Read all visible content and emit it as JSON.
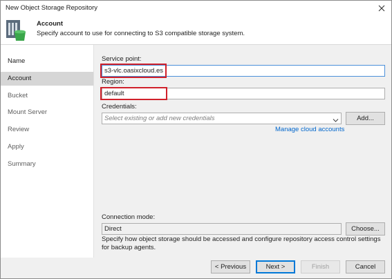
{
  "window": {
    "title": "New Object Storage Repository"
  },
  "header": {
    "title": "Account",
    "subtitle": "Specify account to use for connecting to S3 compatible storage system.",
    "icon": "storage-repository-icon"
  },
  "sidebar": {
    "steps": [
      {
        "label": "Name",
        "state": "done"
      },
      {
        "label": "Account",
        "state": "active"
      },
      {
        "label": "Bucket",
        "state": "pending"
      },
      {
        "label": "Mount Server",
        "state": "pending"
      },
      {
        "label": "Review",
        "state": "pending"
      },
      {
        "label": "Apply",
        "state": "pending"
      },
      {
        "label": "Summary",
        "state": "pending"
      }
    ]
  },
  "form": {
    "service_point": {
      "label": "Service point:",
      "value": "s3-vlc.oasixcloud.es"
    },
    "region": {
      "label": "Region:",
      "value": "default"
    },
    "credentials": {
      "label": "Credentials:",
      "placeholder": "Select existing or add new credentials",
      "add_label": "Add..."
    },
    "manage_link": "Manage cloud accounts",
    "connection_mode": {
      "label": "Connection mode:",
      "value": "Direct",
      "choose_label": "Choose...",
      "description": "Specify how object storage should be accessed and configure repository access control settings for backup agents."
    }
  },
  "footer": {
    "previous": "< Previous",
    "next": "Next >",
    "finish": "Finish",
    "cancel": "Cancel"
  },
  "colors": {
    "highlight": "#d0202a",
    "link": "#0066cc",
    "accent": "#0078d7"
  }
}
